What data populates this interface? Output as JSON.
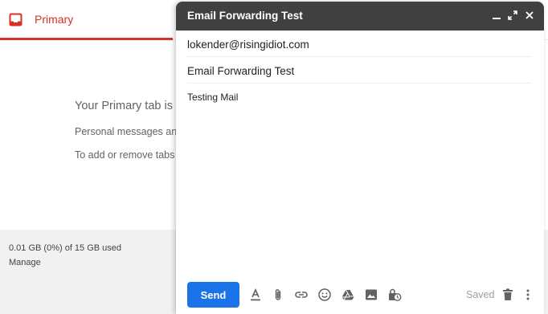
{
  "inbox": {
    "tab_primary_label": "Primary",
    "empty_title": "Your Primary tab is",
    "empty_line1": "Personal messages an",
    "empty_line2": "To add or remove tabs",
    "storage_text": "0.01 GB (0%) of 15 GB used",
    "manage_label": "Manage"
  },
  "compose": {
    "title": "Email Forwarding Test",
    "to_value": "lokender@risingidiot.com",
    "subject_value": "Email Forwarding Test",
    "body_text": "Testing Mail",
    "send_label": "Send",
    "saved_status": "Saved",
    "header_icons": [
      "minimize-icon",
      "expand-icon",
      "close-icon"
    ],
    "toolbar_icons": [
      "format-text-icon",
      "attach-icon",
      "link-icon",
      "emoji-icon",
      "drive-icon",
      "photo-icon",
      "confidential-icon"
    ]
  },
  "colors": {
    "accent_red": "#d93025",
    "send_blue": "#1a73e8",
    "header_dark": "#404040"
  }
}
